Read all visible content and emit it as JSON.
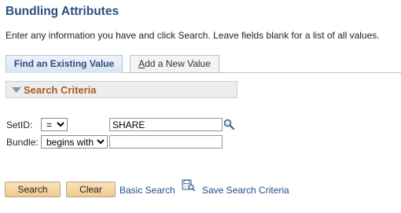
{
  "page": {
    "title": "Bundling Attributes",
    "instructions": "Enter any information you have and click Search. Leave fields blank for a list of all values."
  },
  "tabs": [
    {
      "label": "Find an Existing Value",
      "active": true
    },
    {
      "label_prefix": "A",
      "label_rest": "dd a New Value",
      "active": false
    }
  ],
  "search_criteria": {
    "title": "Search Criteria",
    "fields": {
      "setid": {
        "label": "SetID:",
        "operator": "=",
        "value": "SHARE"
      },
      "bundle": {
        "label": "Bundle:",
        "operator": "begins with",
        "value": ""
      }
    }
  },
  "actions": {
    "search_label": "Search",
    "clear_label": "Clear",
    "basic_search_label": "Basic Search",
    "save_criteria_label": "Save Search Criteria"
  },
  "colors": {
    "title": "#2b4f7c",
    "group_title": "#b05a1a",
    "link": "#1f4d8c",
    "button": "#f4d59f"
  },
  "icons": [
    "lookup-magnifier-icon",
    "save-search-icon",
    "collapse-triangle-icon"
  ]
}
